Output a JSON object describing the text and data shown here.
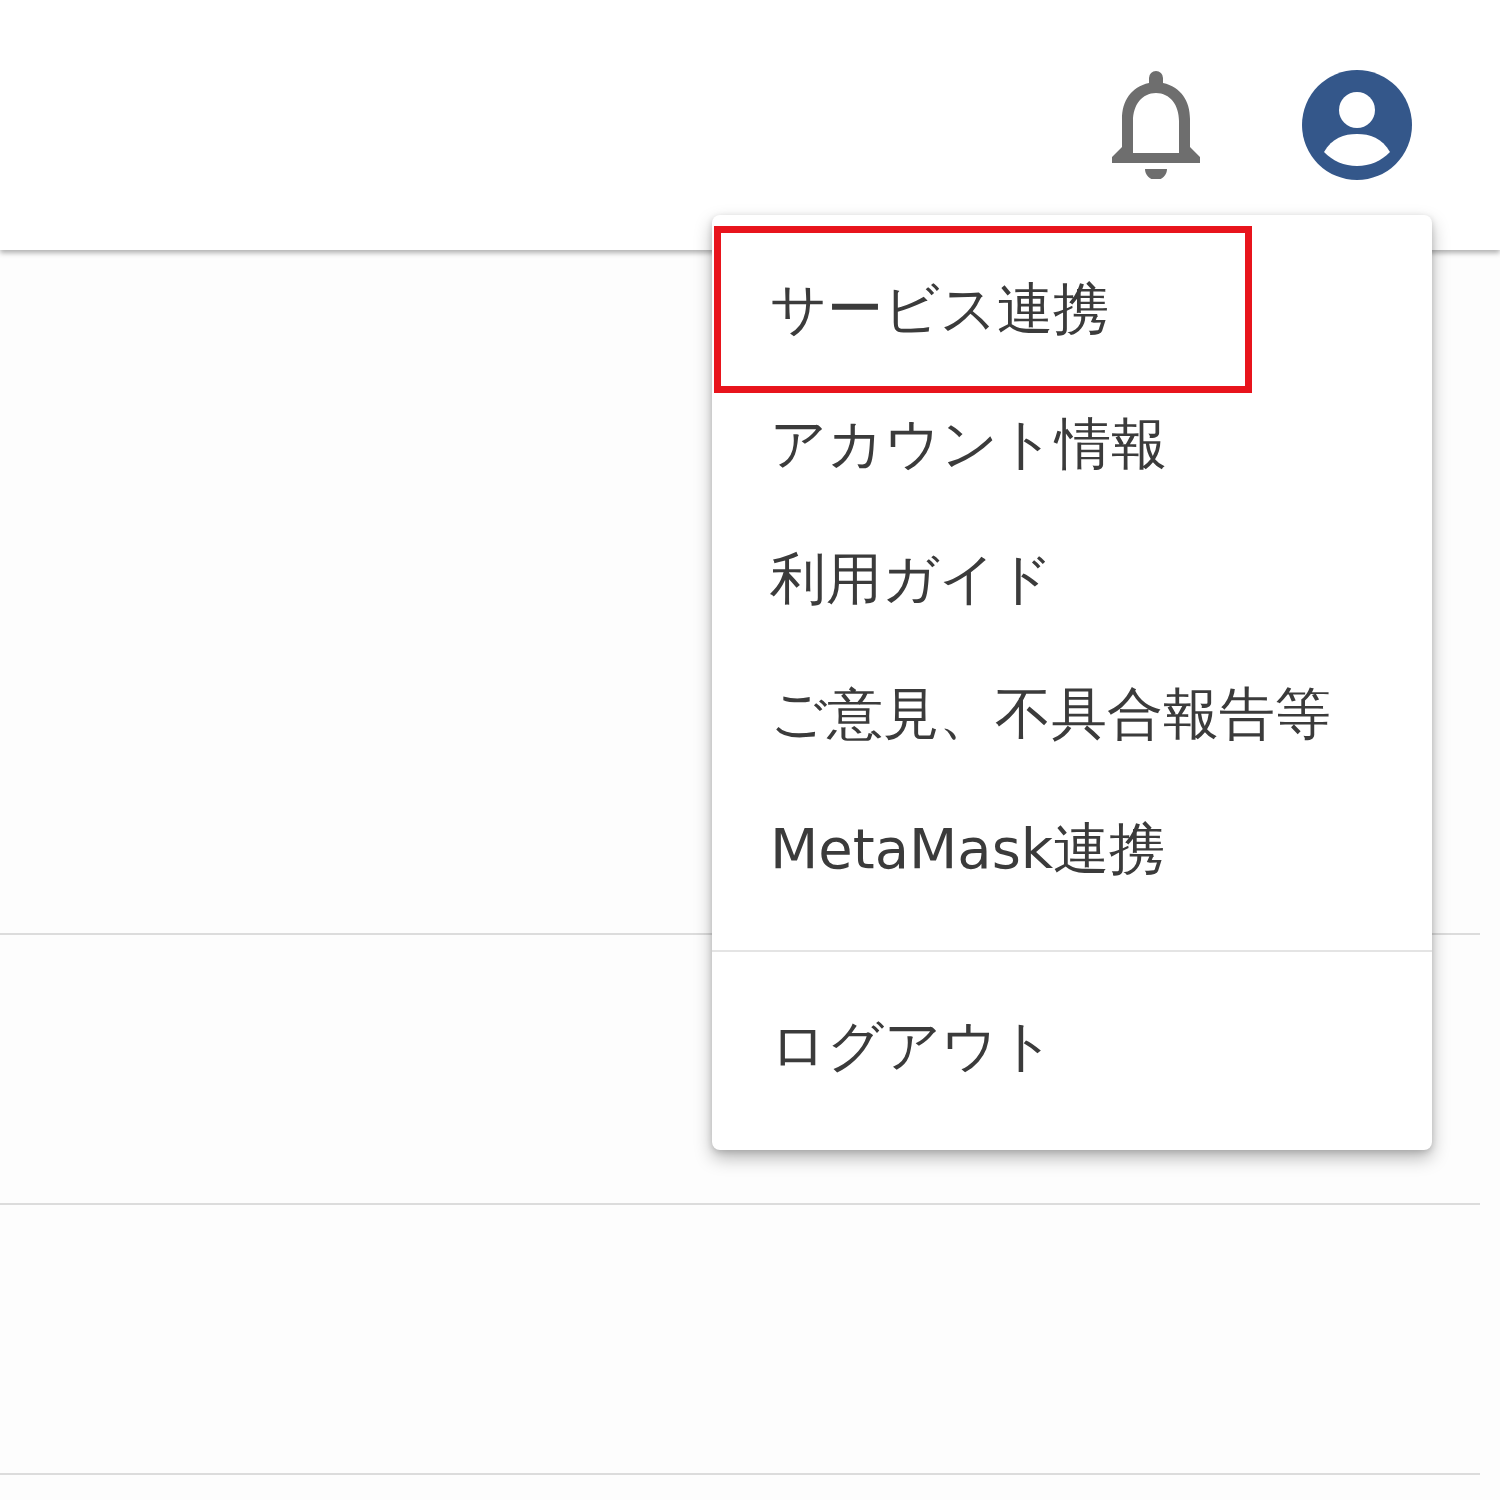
{
  "header": {
    "notifications": {
      "kind": "bell"
    },
    "account": {
      "kind": "avatar"
    }
  },
  "account_menu": {
    "items": [
      {
        "label": "サービス連携",
        "highlighted": true
      },
      {
        "label": "アカウント情報",
        "highlighted": false
      },
      {
        "label": "利用ガイド",
        "highlighted": false
      },
      {
        "label": "ご意見、不具合報告等",
        "highlighted": false
      },
      {
        "label": "MetaMask連携",
        "highlighted": false
      }
    ],
    "footer_items": [
      {
        "label": "ログアウト",
        "highlighted": false
      }
    ]
  }
}
